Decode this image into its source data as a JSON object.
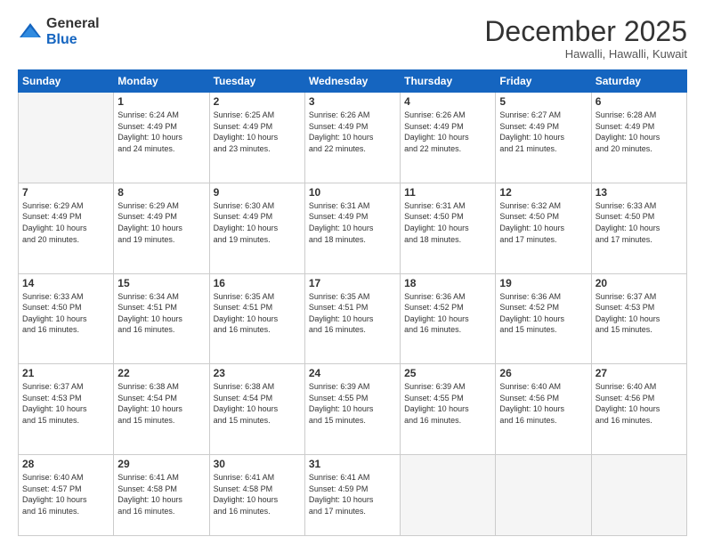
{
  "logo": {
    "general": "General",
    "blue": "Blue"
  },
  "header": {
    "month": "December 2025",
    "location": "Hawalli, Hawalli, Kuwait"
  },
  "days_of_week": [
    "Sunday",
    "Monday",
    "Tuesday",
    "Wednesday",
    "Thursday",
    "Friday",
    "Saturday"
  ],
  "weeks": [
    [
      {
        "day": "",
        "info": ""
      },
      {
        "day": "1",
        "info": "Sunrise: 6:24 AM\nSunset: 4:49 PM\nDaylight: 10 hours\nand 24 minutes."
      },
      {
        "day": "2",
        "info": "Sunrise: 6:25 AM\nSunset: 4:49 PM\nDaylight: 10 hours\nand 23 minutes."
      },
      {
        "day": "3",
        "info": "Sunrise: 6:26 AM\nSunset: 4:49 PM\nDaylight: 10 hours\nand 22 minutes."
      },
      {
        "day": "4",
        "info": "Sunrise: 6:26 AM\nSunset: 4:49 PM\nDaylight: 10 hours\nand 22 minutes."
      },
      {
        "day": "5",
        "info": "Sunrise: 6:27 AM\nSunset: 4:49 PM\nDaylight: 10 hours\nand 21 minutes."
      },
      {
        "day": "6",
        "info": "Sunrise: 6:28 AM\nSunset: 4:49 PM\nDaylight: 10 hours\nand 20 minutes."
      }
    ],
    [
      {
        "day": "7",
        "info": "Sunrise: 6:29 AM\nSunset: 4:49 PM\nDaylight: 10 hours\nand 20 minutes."
      },
      {
        "day": "8",
        "info": "Sunrise: 6:29 AM\nSunset: 4:49 PM\nDaylight: 10 hours\nand 19 minutes."
      },
      {
        "day": "9",
        "info": "Sunrise: 6:30 AM\nSunset: 4:49 PM\nDaylight: 10 hours\nand 19 minutes."
      },
      {
        "day": "10",
        "info": "Sunrise: 6:31 AM\nSunset: 4:49 PM\nDaylight: 10 hours\nand 18 minutes."
      },
      {
        "day": "11",
        "info": "Sunrise: 6:31 AM\nSunset: 4:50 PM\nDaylight: 10 hours\nand 18 minutes."
      },
      {
        "day": "12",
        "info": "Sunrise: 6:32 AM\nSunset: 4:50 PM\nDaylight: 10 hours\nand 17 minutes."
      },
      {
        "day": "13",
        "info": "Sunrise: 6:33 AM\nSunset: 4:50 PM\nDaylight: 10 hours\nand 17 minutes."
      }
    ],
    [
      {
        "day": "14",
        "info": "Sunrise: 6:33 AM\nSunset: 4:50 PM\nDaylight: 10 hours\nand 16 minutes."
      },
      {
        "day": "15",
        "info": "Sunrise: 6:34 AM\nSunset: 4:51 PM\nDaylight: 10 hours\nand 16 minutes."
      },
      {
        "day": "16",
        "info": "Sunrise: 6:35 AM\nSunset: 4:51 PM\nDaylight: 10 hours\nand 16 minutes."
      },
      {
        "day": "17",
        "info": "Sunrise: 6:35 AM\nSunset: 4:51 PM\nDaylight: 10 hours\nand 16 minutes."
      },
      {
        "day": "18",
        "info": "Sunrise: 6:36 AM\nSunset: 4:52 PM\nDaylight: 10 hours\nand 16 minutes."
      },
      {
        "day": "19",
        "info": "Sunrise: 6:36 AM\nSunset: 4:52 PM\nDaylight: 10 hours\nand 15 minutes."
      },
      {
        "day": "20",
        "info": "Sunrise: 6:37 AM\nSunset: 4:53 PM\nDaylight: 10 hours\nand 15 minutes."
      }
    ],
    [
      {
        "day": "21",
        "info": "Sunrise: 6:37 AM\nSunset: 4:53 PM\nDaylight: 10 hours\nand 15 minutes."
      },
      {
        "day": "22",
        "info": "Sunrise: 6:38 AM\nSunset: 4:54 PM\nDaylight: 10 hours\nand 15 minutes."
      },
      {
        "day": "23",
        "info": "Sunrise: 6:38 AM\nSunset: 4:54 PM\nDaylight: 10 hours\nand 15 minutes."
      },
      {
        "day": "24",
        "info": "Sunrise: 6:39 AM\nSunset: 4:55 PM\nDaylight: 10 hours\nand 15 minutes."
      },
      {
        "day": "25",
        "info": "Sunrise: 6:39 AM\nSunset: 4:55 PM\nDaylight: 10 hours\nand 16 minutes."
      },
      {
        "day": "26",
        "info": "Sunrise: 6:40 AM\nSunset: 4:56 PM\nDaylight: 10 hours\nand 16 minutes."
      },
      {
        "day": "27",
        "info": "Sunrise: 6:40 AM\nSunset: 4:56 PM\nDaylight: 10 hours\nand 16 minutes."
      }
    ],
    [
      {
        "day": "28",
        "info": "Sunrise: 6:40 AM\nSunset: 4:57 PM\nDaylight: 10 hours\nand 16 minutes."
      },
      {
        "day": "29",
        "info": "Sunrise: 6:41 AM\nSunset: 4:58 PM\nDaylight: 10 hours\nand 16 minutes."
      },
      {
        "day": "30",
        "info": "Sunrise: 6:41 AM\nSunset: 4:58 PM\nDaylight: 10 hours\nand 16 minutes."
      },
      {
        "day": "31",
        "info": "Sunrise: 6:41 AM\nSunset: 4:59 PM\nDaylight: 10 hours\nand 17 minutes."
      },
      {
        "day": "",
        "info": ""
      },
      {
        "day": "",
        "info": ""
      },
      {
        "day": "",
        "info": ""
      }
    ]
  ]
}
